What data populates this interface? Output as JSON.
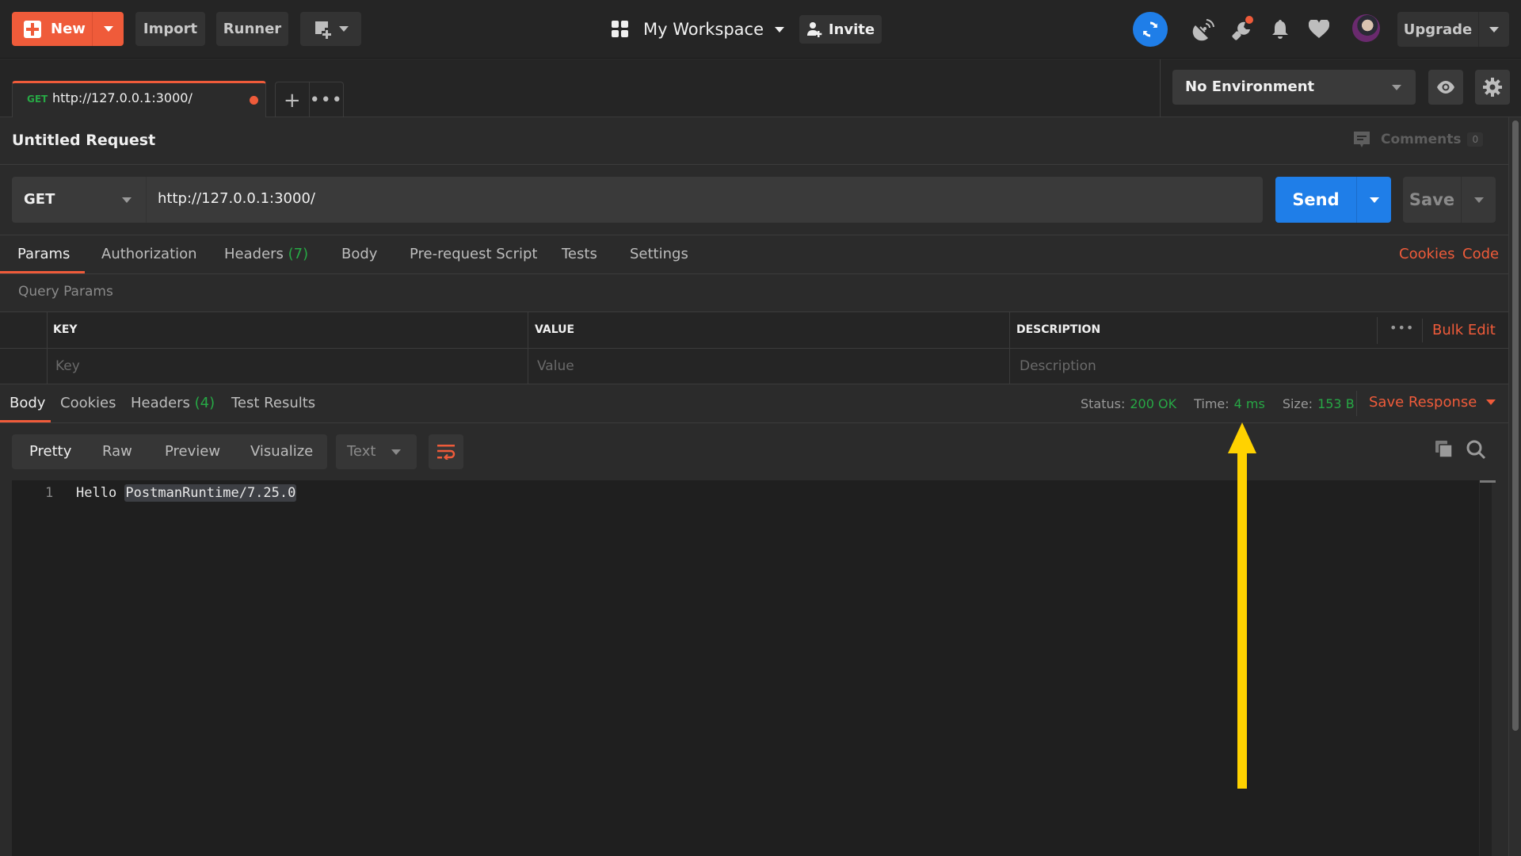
{
  "topbar": {
    "new_label": "New",
    "import_label": "Import",
    "runner_label": "Runner",
    "workspace_label": "My Workspace",
    "invite_label": "Invite",
    "upgrade_label": "Upgrade",
    "icons": {
      "new": "plus-square-icon",
      "new_window": "new-window-icon",
      "workspace": "grid-icon",
      "invite": "user-plus-icon",
      "sync": "sync-icon",
      "interceptor": "satellite-dish-icon",
      "settings": "wrench-icon",
      "notifications": "bell-icon",
      "heart": "heart-icon",
      "avatar": "user-avatar"
    }
  },
  "tabs": [
    {
      "method": "GET",
      "label": "http://127.0.0.1:3000/",
      "unsaved": true
    }
  ],
  "environment": {
    "selected": "No Environment"
  },
  "request": {
    "title": "Untitled Request",
    "comments_label": "Comments",
    "comments_count": "0",
    "method": "GET",
    "url": "http://127.0.0.1:3000/",
    "send_label": "Send",
    "save_label": "Save",
    "tabs": [
      {
        "label": "Params",
        "count": "",
        "active": true
      },
      {
        "label": "Authorization",
        "count": ""
      },
      {
        "label": "Headers",
        "count": "(7)"
      },
      {
        "label": "Body",
        "count": ""
      },
      {
        "label": "Pre-request Script",
        "count": ""
      },
      {
        "label": "Tests",
        "count": ""
      },
      {
        "label": "Settings",
        "count": ""
      }
    ],
    "cookies_link": "Cookies",
    "code_link": "Code",
    "query_params": {
      "title": "Query Params",
      "columns": [
        "KEY",
        "VALUE",
        "DESCRIPTION"
      ],
      "bulk_edit_label": "Bulk Edit",
      "placeholders": {
        "key": "Key",
        "value": "Value",
        "description": "Description"
      }
    }
  },
  "response": {
    "tabs": [
      {
        "label": "Body",
        "count": "",
        "active": true
      },
      {
        "label": "Cookies",
        "count": ""
      },
      {
        "label": "Headers",
        "count": "(4)"
      },
      {
        "label": "Test Results",
        "count": ""
      }
    ],
    "status_label": "Status:",
    "status_value": "200 OK",
    "time_label": "Time:",
    "time_value": "4 ms",
    "size_label": "Size:",
    "size_value": "153 B",
    "save_response_label": "Save Response",
    "view_modes": [
      "Pretty",
      "Raw",
      "Preview",
      "Visualize"
    ],
    "active_view": "Pretty",
    "format": "Text",
    "body_lines": [
      {
        "number": "1",
        "text": "Hello ",
        "highlight": "PostmanRuntime/7.25.0"
      }
    ]
  },
  "annotation": {
    "type": "arrow",
    "color": "#ffd200",
    "points_to": "Time: 4 ms"
  },
  "colors": {
    "accent_orange": "#ef5b3a",
    "send_blue": "#1f7ee8",
    "success_green": "#27a845",
    "background": "#2b2b2b"
  }
}
